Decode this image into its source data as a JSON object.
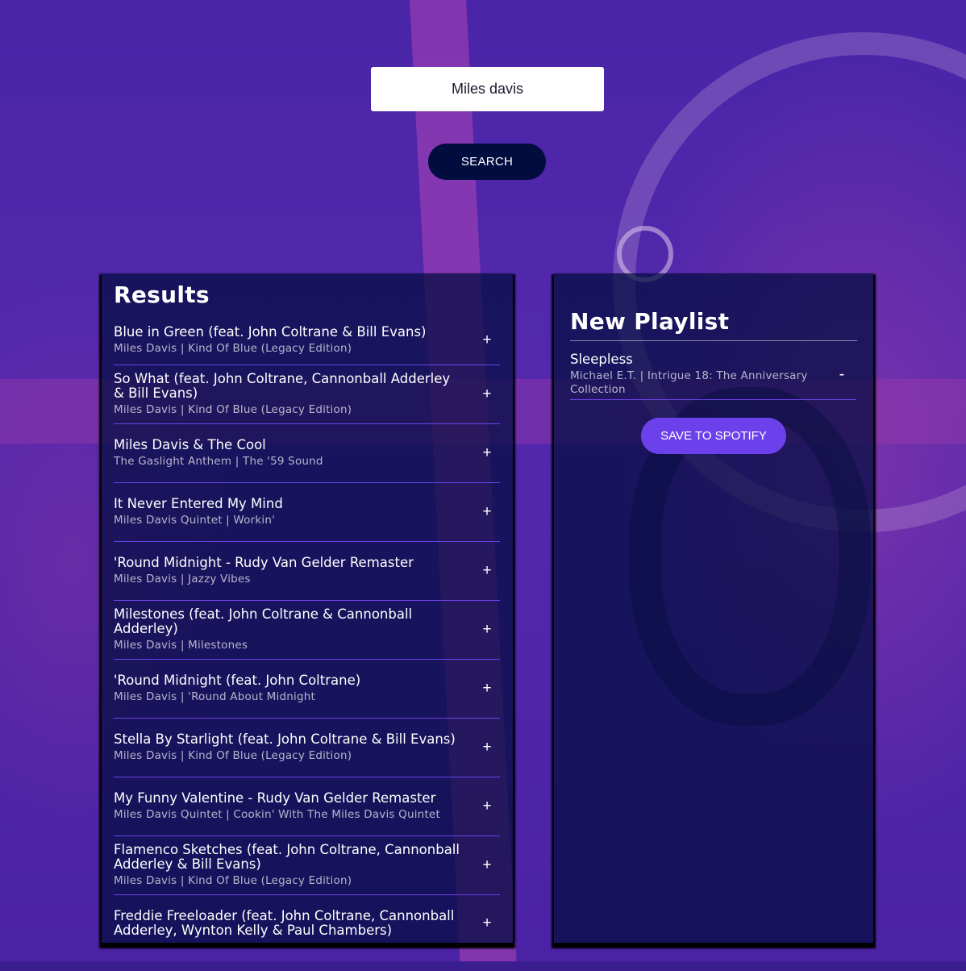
{
  "search": {
    "value": "Miles davis",
    "button_label": "SEARCH"
  },
  "results": {
    "title": "Results",
    "tracks": [
      {
        "name": "Blue in Green (feat. John Coltrane & Bill Evans)",
        "meta": "Miles Davis | Kind Of Blue (Legacy Edition)",
        "action": "+"
      },
      {
        "name": "So What (feat. John Coltrane, Cannonball Adderley & Bill Evans)",
        "meta": "Miles Davis | Kind Of Blue (Legacy Edition)",
        "action": "+"
      },
      {
        "name": "Miles Davis & The Cool",
        "meta": "The Gaslight Anthem | The '59 Sound",
        "action": "+"
      },
      {
        "name": "It Never Entered My Mind",
        "meta": "Miles Davis Quintet | Workin'",
        "action": "+"
      },
      {
        "name": "'Round Midnight - Rudy Van Gelder Remaster",
        "meta": "Miles Davis | Jazzy Vibes",
        "action": "+"
      },
      {
        "name": "Milestones (feat. John Coltrane & Cannonball Adderley)",
        "meta": "Miles Davis | Milestones",
        "action": "+"
      },
      {
        "name": "'Round Midnight (feat. John Coltrane)",
        "meta": "Miles Davis | 'Round About Midnight",
        "action": "+"
      },
      {
        "name": "Stella By Starlight (feat. John Coltrane & Bill Evans)",
        "meta": "Miles Davis | Kind Of Blue (Legacy Edition)",
        "action": "+"
      },
      {
        "name": "My Funny Valentine - Rudy Van Gelder Remaster",
        "meta": "Miles Davis Quintet | Cookin' With The Miles Davis Quintet",
        "action": "+"
      },
      {
        "name": "Flamenco Sketches (feat. John Coltrane, Cannonball Adderley & Bill Evans)",
        "meta": "Miles Davis | Kind Of Blue (Legacy Edition)",
        "action": "+"
      },
      {
        "name": "Freddie Freeloader (feat. John Coltrane, Cannonball Adderley, Wynton Kelly & Paul Chambers)",
        "meta": "",
        "action": "+"
      }
    ]
  },
  "playlist": {
    "title": "New Playlist",
    "tracks": [
      {
        "name": "Sleepless",
        "meta": "Michael E.T. | Intrigue 18: The Anniversary Collection",
        "action": "-"
      }
    ],
    "save_label": "SAVE TO SPOTIFY"
  },
  "colors": {
    "panel": "#010c3f",
    "accent": "#6c41ec",
    "search_button": "#010c3f"
  }
}
